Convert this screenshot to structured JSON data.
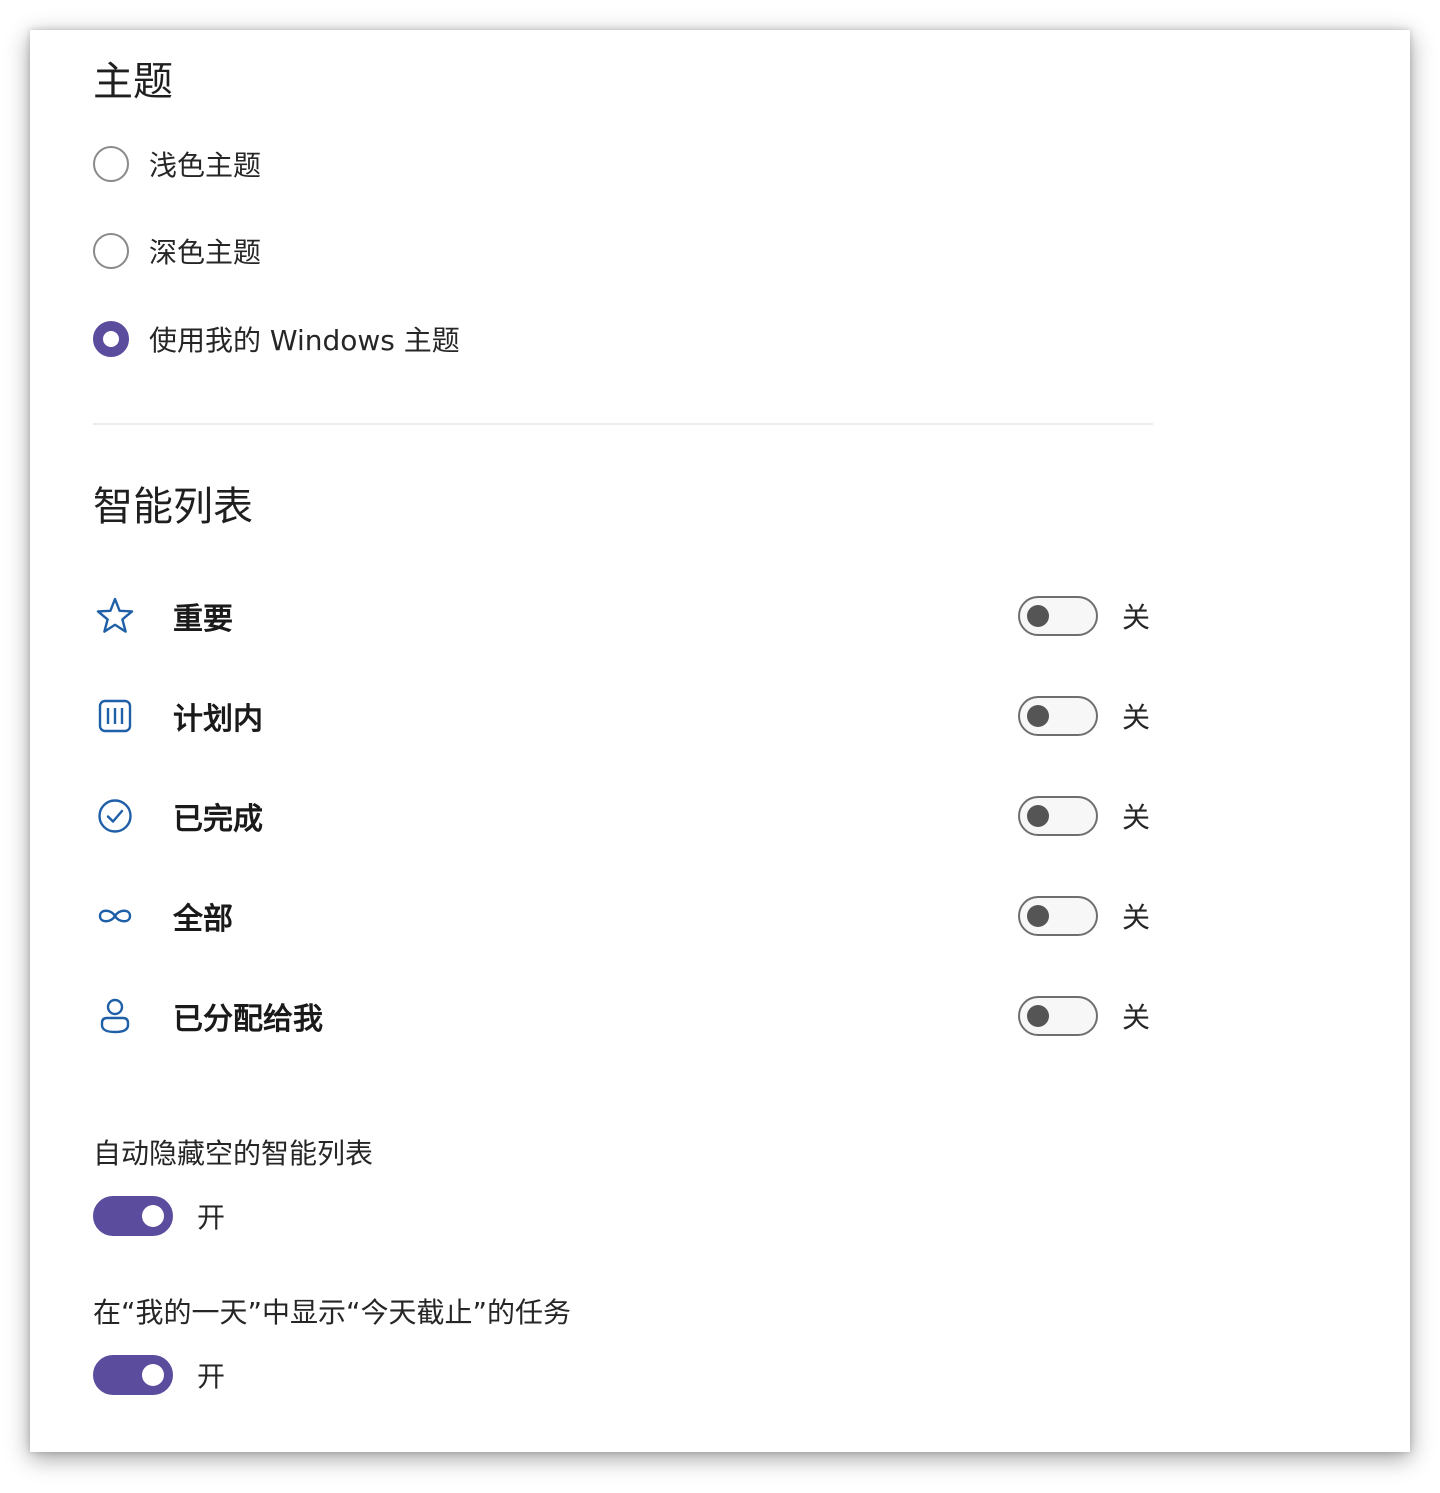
{
  "theme": {
    "title": "主题",
    "options": [
      {
        "label": "浅色主题",
        "checked": false
      },
      {
        "label": "深色主题",
        "checked": false
      },
      {
        "label": "使用我的 Windows 主题",
        "checked": true
      }
    ]
  },
  "smart_lists": {
    "title": "智能列表",
    "items": [
      {
        "label": "重要",
        "icon": "star-icon",
        "state": "关",
        "on": false
      },
      {
        "label": "计划内",
        "icon": "calendar-icon",
        "state": "关",
        "on": false
      },
      {
        "label": "已完成",
        "icon": "check-circle-icon",
        "state": "关",
        "on": false
      },
      {
        "label": "全部",
        "icon": "infinity-icon",
        "state": "关",
        "on": false
      },
      {
        "label": "已分配给我",
        "icon": "person-icon",
        "state": "关",
        "on": false
      }
    ]
  },
  "settings": {
    "auto_hide": {
      "label": "自动隐藏空的智能列表",
      "state": "开",
      "on": true
    },
    "due_today": {
      "label": "在“我的一天”中显示“今天截止”的任务",
      "state": "开",
      "on": true
    }
  },
  "colors": {
    "accent": "#5b4c9e",
    "icon_blue": "#1e5fa8"
  }
}
